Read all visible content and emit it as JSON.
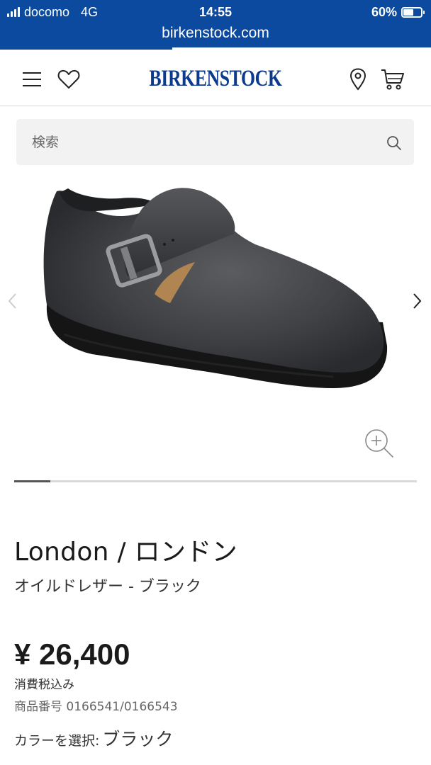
{
  "status_bar": {
    "carrier": "docomo",
    "network": "4G",
    "time": "14:55",
    "battery_percent_label": "60%",
    "battery_level": 0.6,
    "url": "birkenstock.com",
    "load_progress": 0.4
  },
  "header": {
    "logo": "BIRKENSTOCK",
    "icons": [
      "menu-icon",
      "heart-icon",
      "location-pin-icon",
      "cart-icon"
    ]
  },
  "search": {
    "placeholder": "検索"
  },
  "carousel": {
    "current_progress": 0.09
  },
  "product": {
    "name": "London / ロンドン",
    "variant": "オイルドレザー - ブラック",
    "price": "¥ 26,400",
    "tax_note": "消費税込み",
    "sku": "商品番号 0166541/0166543",
    "color_label": "カラーを選択:",
    "color_value": "ブラック"
  },
  "colors": {
    "brand_blue": "#0c3a8c",
    "status_bar_blue": "#0c4aa0"
  }
}
